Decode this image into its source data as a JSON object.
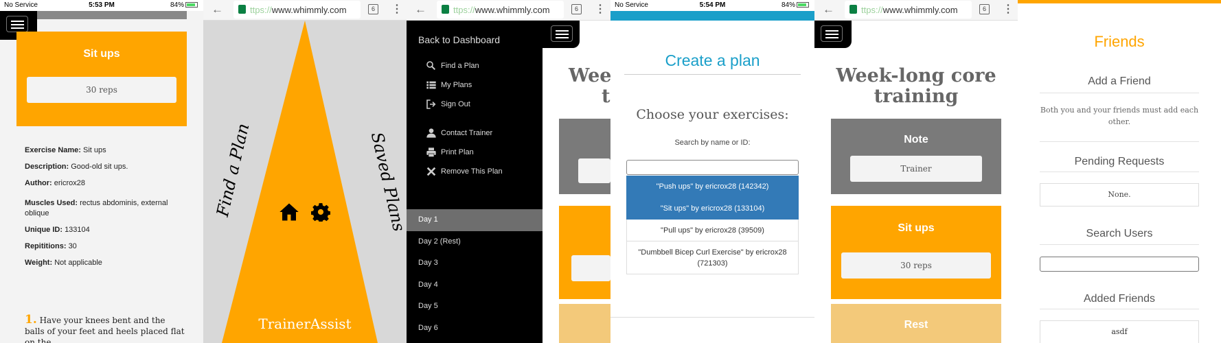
{
  "colors": {
    "orange": "#ffa500",
    "light_orange": "#f3c97a",
    "blue": "#1a9fc9",
    "selected_blue": "#337ab7",
    "gray": "#7a7a7a",
    "black": "#000000"
  },
  "status_bar_1": {
    "carrier": "No Service",
    "time": "5:53 PM",
    "battery": "84%"
  },
  "status_bar_4": {
    "carrier": "No Service",
    "time": "5:54 PM",
    "battery": "84%"
  },
  "browser": {
    "url_https": "ttps://",
    "url_host": "www.whimmly.com",
    "tab_count": "6"
  },
  "panel1": {
    "title": "Sit ups",
    "reps": "30 reps",
    "details": [
      {
        "label": "Exercise Name:",
        "value": "Sit ups"
      },
      {
        "label": "Description:",
        "value": "Good-old sit ups."
      },
      {
        "label": "Author:",
        "value": "ericrox28"
      },
      {
        "label": "Muscles Used:",
        "value": "rectus abdominis, external oblique"
      },
      {
        "label": "Unique ID:",
        "value": "133104"
      },
      {
        "label": "Repititions:",
        "value": "30"
      },
      {
        "label": "Weight:",
        "value": "Not applicable"
      }
    ],
    "step_number": "1.",
    "step_text": "Have your knees bent and the balls of your feet and heels placed flat on the"
  },
  "panel2": {
    "left_label": "Find a Plan",
    "right_label": "Saved Plans",
    "app_name": "TrainerAssist",
    "home_icon": "home-icon",
    "settings_icon": "gear-icon"
  },
  "panel3": {
    "back": "Back to Dashboard",
    "menu": [
      {
        "label": "Find a Plan",
        "icon": "search-icon"
      },
      {
        "label": "My Plans",
        "icon": "list-icon"
      },
      {
        "label": "Sign Out",
        "icon": "sign-out-icon"
      },
      {
        "label": "Contact Trainer",
        "icon": "user-icon"
      },
      {
        "label": "Print Plan",
        "icon": "print-icon"
      },
      {
        "label": "Remove This Plan",
        "icon": "close-icon"
      }
    ],
    "days": [
      "Day 1",
      "Day 2 (Rest)",
      "Day 3",
      "Day 4",
      "Day 5",
      "Day 6"
    ],
    "bg_title_1": "Week",
    "bg_title_2": "t"
  },
  "panel4": {
    "title": "Create a plan",
    "subtitle": "Choose your exercises:",
    "search_label": "Search by name or ID:",
    "search_value": "",
    "results": [
      {
        "text": "\"Push ups\" by ericrox28 (142342)",
        "selected": true
      },
      {
        "text": "\"Sit ups\" by ericrox28 (133104)",
        "selected": true
      },
      {
        "text": "\"Pull ups\" by ericrox28 (39509)",
        "selected": false
      },
      {
        "text": "\"Dumbbell Bicep Curl Exercise\" by ericrox28 (721303)",
        "selected": false
      }
    ]
  },
  "panel5": {
    "title": "Week-long core training",
    "note_title": "Note",
    "note_value": "Trainer",
    "exercise_title": "Sit ups",
    "exercise_reps": "30 reps",
    "rest_title": "Rest"
  },
  "panel6": {
    "title": "Friends",
    "add_heading": "Add a Friend",
    "add_text": "Both you and your friends must add each other.",
    "pending_heading": "Pending Requests",
    "pending_value": "None.",
    "search_heading": "Search Users",
    "search_value": "",
    "added_heading": "Added Friends",
    "added_friends": [
      "asdf"
    ]
  }
}
